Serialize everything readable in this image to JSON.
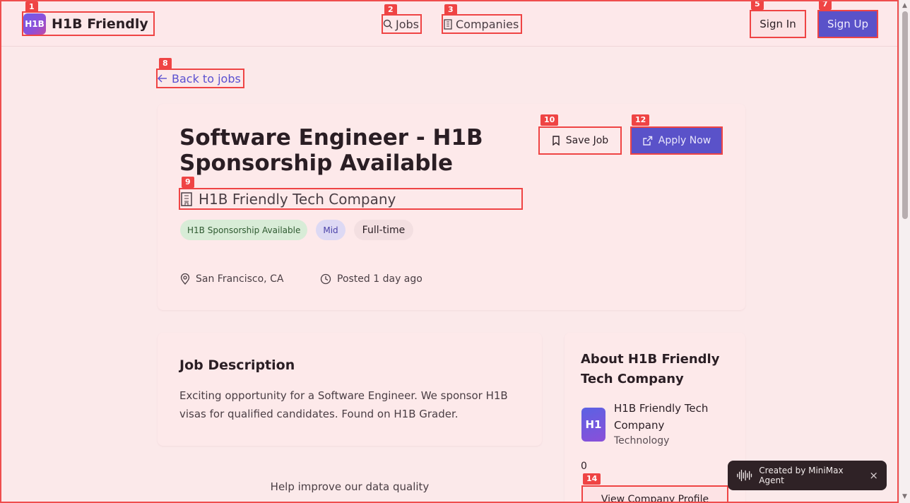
{
  "header": {
    "logo_mark": "H1B",
    "logo_text": "H1B Friendly",
    "nav": {
      "jobs": "Jobs",
      "companies": "Companies"
    },
    "sign_in": "Sign In",
    "sign_up": "Sign Up"
  },
  "back_link": "Back to jobs",
  "job": {
    "title": "Software Engineer - H1B Sponsorship Available",
    "company": "H1B Friendly Tech Company",
    "tags": [
      "H1B Sponsorship Available",
      "Mid",
      "Full-time"
    ],
    "location": "San Francisco, CA",
    "posted": "Posted 1 day ago",
    "save_label": "Save Job",
    "apply_label": "Apply Now"
  },
  "description": {
    "title": "Job Description",
    "text": "Exciting opportunity for a Software Engineer. We sponsor H1B visas for qualified candidates. Found on H1B Grader."
  },
  "help_text": "Help improve our data quality",
  "about": {
    "title": "About H1B Friendly Tech Company",
    "avatar": "H1",
    "name": "H1B Friendly Tech Company",
    "industry": "Technology",
    "count": "0",
    "profile_button": "View Company Profile"
  },
  "toast": {
    "text": "Created by MiniMax Agent",
    "close": "×"
  },
  "badges": [
    "1",
    "2",
    "3",
    "5",
    "7",
    "8",
    "9",
    "10",
    "12",
    "14"
  ],
  "colors": {
    "accent": "#5a52c9",
    "highlight": "#ef4444",
    "background": "#fbe9ea"
  }
}
